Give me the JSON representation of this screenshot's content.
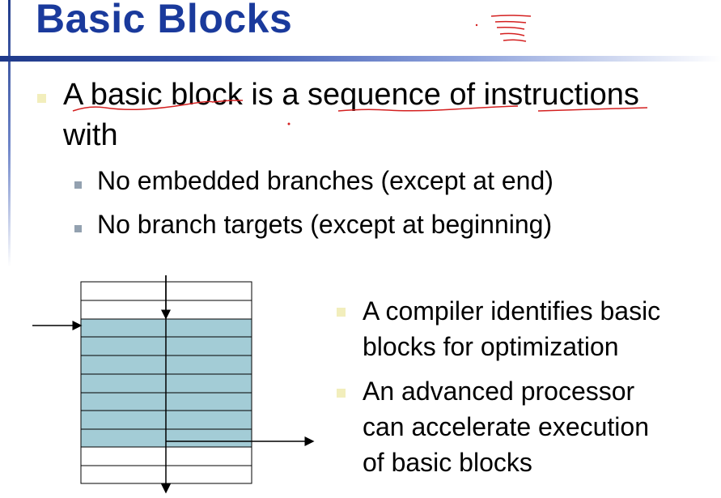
{
  "slide": {
    "title": "Basic Blocks",
    "main_bullet": {
      "line1": "A basic block is a sequence of instructions",
      "line2": "with"
    },
    "sub_bullets": [
      "No embedded branches (except at end)",
      "No branch targets (except at beginning)"
    ],
    "right_bullets": [
      {
        "line1": "A compiler identifies basic",
        "line2": "blocks for optimization"
      },
      {
        "line1": "An advanced processor",
        "line2": "can accelerate execution",
        "line3": "of basic blocks"
      }
    ]
  },
  "colors": {
    "title": "#1a3a9c",
    "block_fill": "#a3ccd6",
    "bullet_main": "#f2eebc",
    "bullet_sub": "#93a1b0",
    "ink_annotation": "#d42020"
  }
}
